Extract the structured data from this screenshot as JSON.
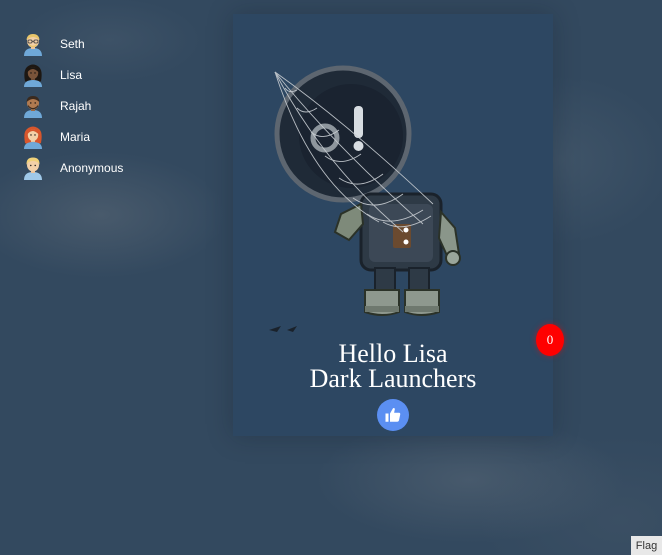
{
  "users": [
    {
      "name": "Seth",
      "avatar": "man-blond-glasses-avatar"
    },
    {
      "name": "Lisa",
      "avatar": "woman-dark-avatar"
    },
    {
      "name": "Rajah",
      "avatar": "man-brown-avatar"
    },
    {
      "name": "Maria",
      "avatar": "woman-red-hair-avatar"
    },
    {
      "name": "Anonymous",
      "avatar": "person-blond-avatar"
    }
  ],
  "card": {
    "illustration": "astronaut-cobweb-illustration",
    "greeting": "Hello Lisa",
    "subtitle": "Dark Launchers",
    "like_icon": "thumbs-up-icon"
  },
  "badge": {
    "count": "0"
  },
  "flag": {
    "label": "Flag"
  },
  "colors": {
    "background": "#33495f",
    "card": "#2d4762",
    "like_button": "#5b8ff2",
    "badge": "#ff0000"
  }
}
